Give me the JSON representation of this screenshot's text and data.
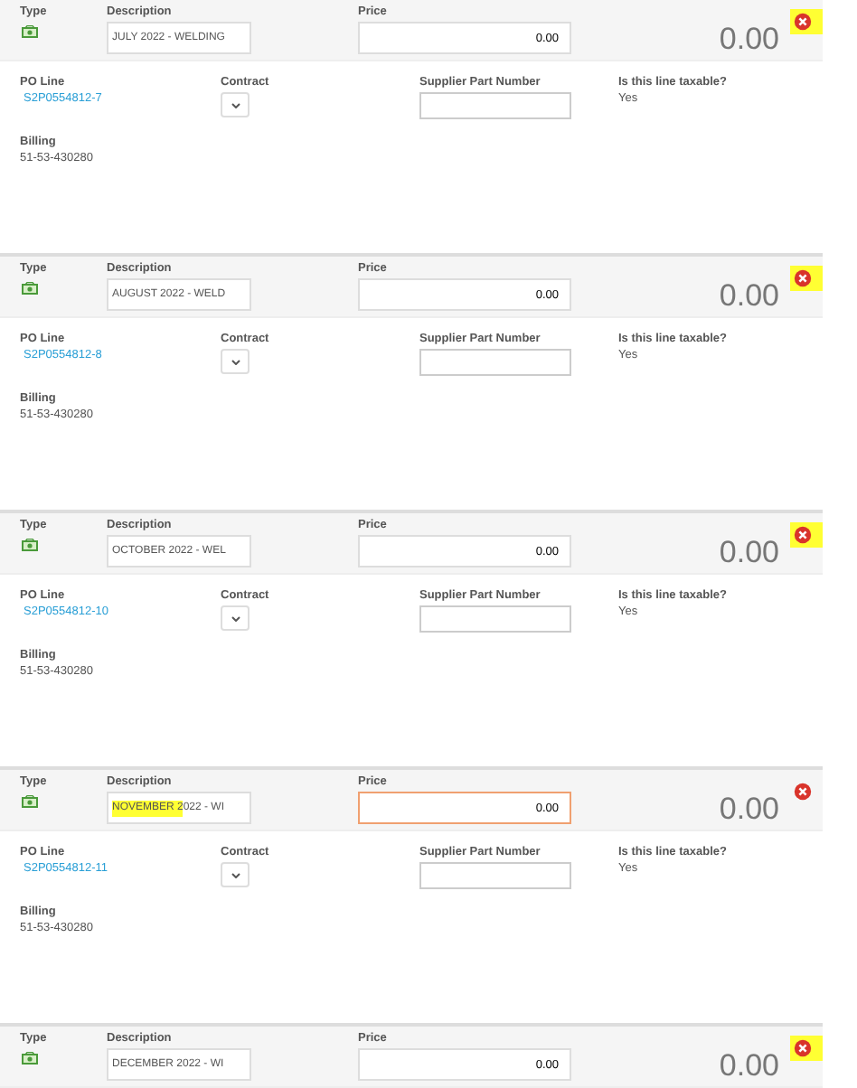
{
  "lines": [
    {
      "type_label": "Type",
      "description_label": "Description",
      "description": "JULY 2022 - WELDING",
      "price_label": "Price",
      "price": "0.00",
      "price_focused": false,
      "total": "0.00",
      "remove_highlighted": true,
      "details": {
        "po_line_label": "PO Line",
        "po_line": "S2P0554812-7",
        "contract_label": "Contract",
        "supplier_part_label": "Supplier Part Number",
        "taxable_label": "Is this line taxable?",
        "taxable": "Yes",
        "billing_label": "Billing",
        "billing": "51-53-430280"
      }
    },
    {
      "type_label": "Type",
      "description_label": "Description",
      "description": "AUGUST 2022 - WELD",
      "price_label": "Price",
      "price": "0.00",
      "price_focused": false,
      "total": "0.00",
      "remove_highlighted": true,
      "details": {
        "po_line_label": "PO Line",
        "po_line": "S2P0554812-8",
        "contract_label": "Contract",
        "supplier_part_label": "Supplier Part Number",
        "taxable_label": "Is this line taxable?",
        "taxable": "Yes",
        "billing_label": "Billing",
        "billing": "51-53-430280"
      }
    },
    {
      "type_label": "Type",
      "description_label": "Description",
      "description": "OCTOBER 2022 - WEL",
      "price_label": "Price",
      "price": "0.00",
      "price_focused": false,
      "total": "0.00",
      "remove_highlighted": true,
      "details": {
        "po_line_label": "PO Line",
        "po_line": "S2P0554812-10",
        "contract_label": "Contract",
        "supplier_part_label": "Supplier Part Number",
        "taxable_label": "Is this line taxable?",
        "taxable": "Yes",
        "billing_label": "Billing",
        "billing": "51-53-430280"
      }
    },
    {
      "type_label": "Type",
      "description_label": "Description",
      "description": "022 - WI",
      "description_highlight": "NOVEMBER 2",
      "price_label": "Price",
      "price": "0.00",
      "price_focused": true,
      "total": "0.00",
      "remove_highlighted": false,
      "details": {
        "po_line_label": "PO Line",
        "po_line": "S2P0554812-11",
        "contract_label": "Contract",
        "supplier_part_label": "Supplier Part Number",
        "taxable_label": "Is this line taxable?",
        "taxable": "Yes",
        "billing_label": "Billing",
        "billing": "51-53-430280"
      }
    },
    {
      "type_label": "Type",
      "description_label": "Description",
      "description": "DECEMBER 2022 - WI",
      "price_label": "Price",
      "price": "0.00",
      "price_focused": false,
      "total": "0.00",
      "remove_highlighted": true
    }
  ]
}
